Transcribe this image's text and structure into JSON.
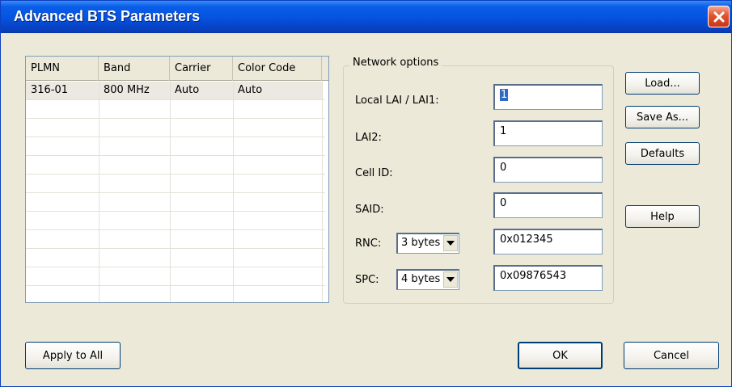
{
  "window": {
    "title": "Advanced BTS Parameters"
  },
  "table": {
    "columns": [
      "PLMN",
      "Band",
      "Carrier",
      "Color Code"
    ],
    "rows": [
      {
        "plmn": "316-01",
        "band": "800 MHz",
        "carrier": "Auto",
        "color_code": "Auto"
      }
    ]
  },
  "network": {
    "legend": "Network options",
    "local_lai_label": "Local LAI / LAI1:",
    "local_lai_value": "1",
    "lai2_label": "LAI2:",
    "lai2_value": "1",
    "cell_id_label": "Cell ID:",
    "cell_id_value": "0",
    "said_label": "SAID:",
    "said_value": "0",
    "rnc_label": "RNC:",
    "rnc_select": "3 bytes",
    "rnc_value": "0x012345",
    "spc_label": "SPC:",
    "spc_select": "4 bytes",
    "spc_value": "0x09876543"
  },
  "buttons": {
    "load": "Load...",
    "save_as": "Save As...",
    "defaults": "Defaults",
    "help": "Help",
    "apply_to_all": "Apply to All",
    "ok": "OK",
    "cancel": "Cancel"
  },
  "icons": {
    "close": "close-icon",
    "dropdown": "chevron-down-icon"
  },
  "colors": {
    "titlebar": "#0553e0",
    "close_button": "#e1532d",
    "selection": "#316ac5"
  }
}
